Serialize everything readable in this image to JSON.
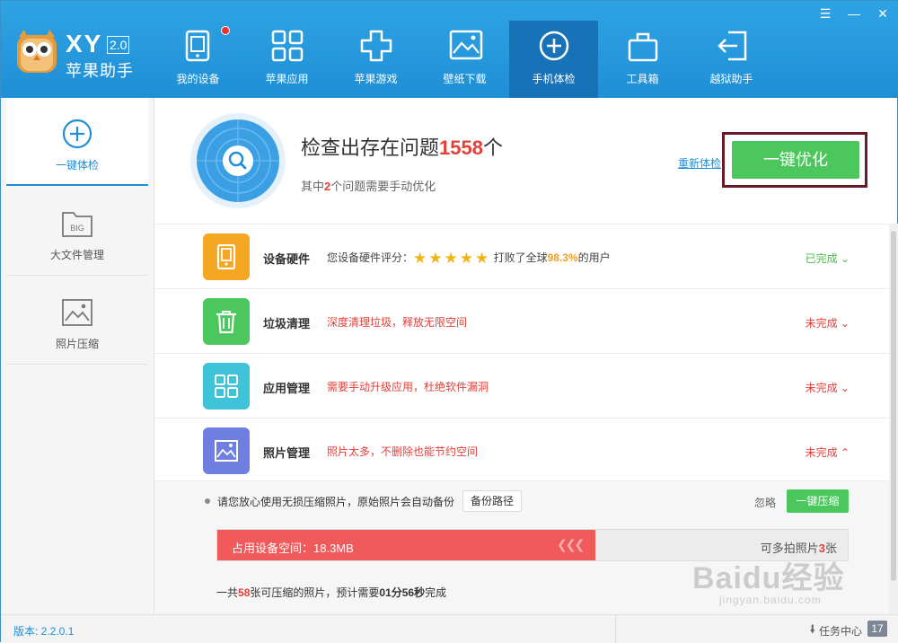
{
  "header": {
    "brand_xy": "XY",
    "brand_version": "2.0",
    "brand_name": "苹果助手",
    "nav": [
      {
        "label": "我的设备",
        "icon": "tablet-icon"
      },
      {
        "label": "苹果应用",
        "icon": "grid-apps-icon"
      },
      {
        "label": "苹果游戏",
        "icon": "gamepad-icon"
      },
      {
        "label": "壁纸下载",
        "icon": "image-icon"
      },
      {
        "label": "手机体检",
        "icon": "plus-circle-icon"
      },
      {
        "label": "工具箱",
        "icon": "toolbox-icon"
      },
      {
        "label": "越狱助手",
        "icon": "exit-arrow-icon"
      }
    ],
    "active_nav": "手机体检"
  },
  "sidebar": {
    "items": [
      {
        "label": "一键体检",
        "icon": "plus-circle-icon"
      },
      {
        "label": "大文件管理",
        "icon": "big-file-icon"
      },
      {
        "label": "照片压缩",
        "icon": "photo-icon"
      }
    ]
  },
  "summary": {
    "title_prefix": "检查出存在问题",
    "title_count": "1558",
    "title_suffix": "个",
    "sub_prefix": "其中",
    "sub_count": "2",
    "sub_suffix": "个问题需要手动优化",
    "rescan": "重新体检",
    "optimize": "一键优化"
  },
  "rows": [
    {
      "name": "设备硬件",
      "desc_prefix": "您设备硬件评分：",
      "stars": "★★★★★",
      "desc_mid": "打败了全球",
      "percent": "98.3%",
      "desc_suffix": "的用户",
      "status": "已完成",
      "status_color": "#4cb84c"
    },
    {
      "name": "垃圾清理",
      "desc": "深度清理垃圾，释放无限空间",
      "status": "未完成",
      "status_color": "#e3403a"
    },
    {
      "name": "应用管理",
      "desc": "需要手动升级应用，杜绝软件漏洞",
      "status": "未完成",
      "status_color": "#e3403a"
    },
    {
      "name": "照片管理",
      "desc": "照片太多，不删除也能节约空间",
      "status": "未完成",
      "status_color": "#e3403a"
    }
  ],
  "panel": {
    "tip": "请您放心使用无损压缩照片，原始照片会自动备份",
    "backup": "备份路径",
    "ignore": "忽略",
    "compress": "一键压缩",
    "bar_label": "占用设备空间：18.3MB",
    "bar_fraction": 0.6,
    "bar_right_prefix": "可多拍照片",
    "bar_right_count": "3",
    "bar_right_suffix": "张",
    "summary_prefix": "一共",
    "summary_count": "58",
    "summary_mid": "张可压缩的照片，预计需要",
    "summary_time": "01分56秒",
    "summary_suffix": "完成"
  },
  "footer": {
    "version": "版本: 2.2.0.1",
    "task": "任务中心",
    "task_count": "17"
  },
  "watermark": {
    "main": "Baidu经验",
    "sub": "jingyan.baidu.com"
  },
  "colors": {
    "header_blue": "#1f8fd6",
    "accent_green": "#4cc75d",
    "alert_red": "#e3403a",
    "highlight_border": "#6a1a26"
  }
}
